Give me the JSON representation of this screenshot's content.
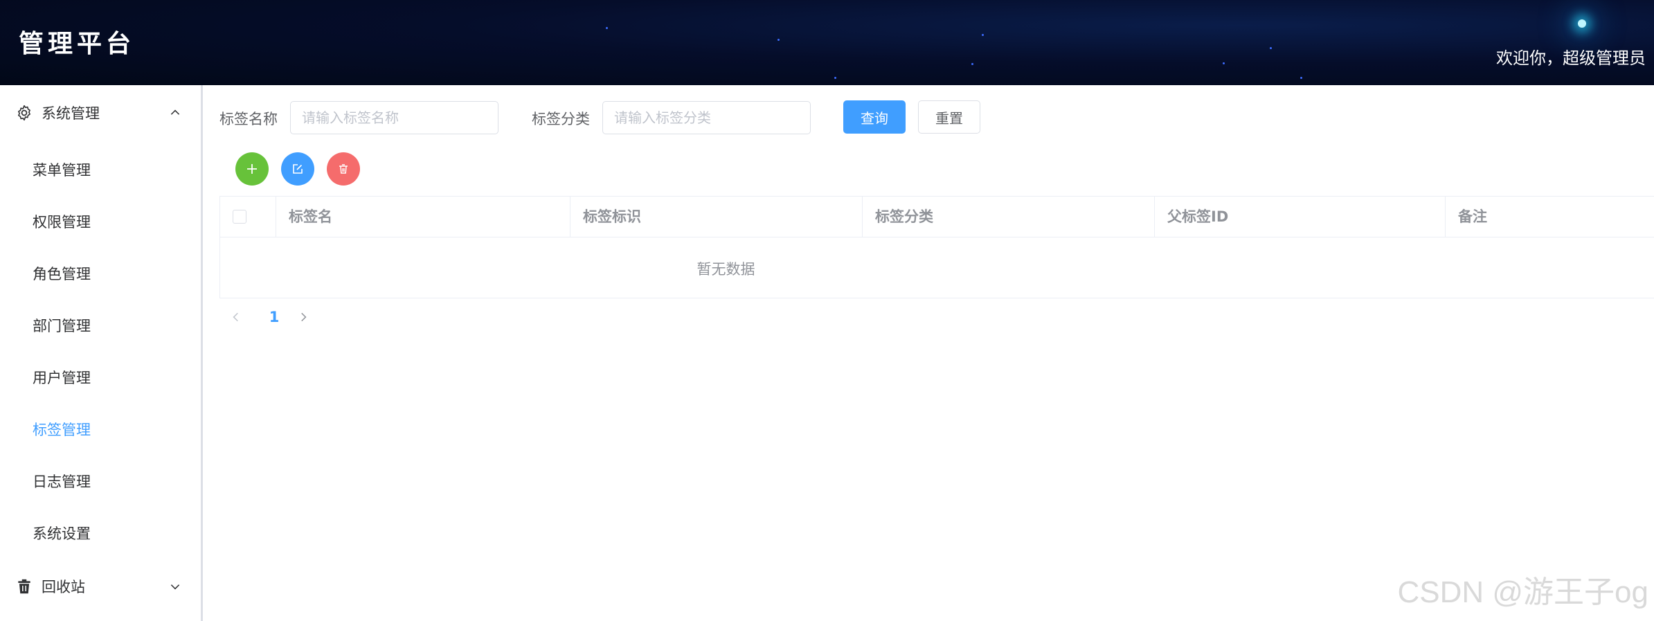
{
  "header": {
    "logo": "管理平台",
    "welcome": "欢迎你，超级管理员"
  },
  "sidebar": {
    "groups": [
      {
        "label": "系统管理",
        "icon": "gear-icon",
        "expanded": true
      },
      {
        "label": "回收站",
        "icon": "trash-icon",
        "expanded": false
      }
    ],
    "items": [
      {
        "label": "菜单管理"
      },
      {
        "label": "权限管理"
      },
      {
        "label": "角色管理"
      },
      {
        "label": "部门管理"
      },
      {
        "label": "用户管理"
      },
      {
        "label": "标签管理",
        "active": true
      },
      {
        "label": "日志管理"
      },
      {
        "label": "系统设置"
      }
    ]
  },
  "search": {
    "name_label": "标签名称",
    "name_placeholder": "请输入标签名称",
    "category_label": "标签分类",
    "category_placeholder": "请输入标签分类",
    "query_button": "查询",
    "reset_button": "重置"
  },
  "toolbar": {
    "add_icon": "plus-icon",
    "edit_icon": "edit-icon",
    "delete_icon": "delete-icon"
  },
  "table": {
    "columns": [
      "标签名",
      "标签标识",
      "标签分类",
      "父标签ID",
      "备注"
    ],
    "empty_text": "暂无数据"
  },
  "pagination": {
    "current_page": "1"
  },
  "watermark": "CSDN @游王子og",
  "colors": {
    "primary": "#409eff",
    "success": "#67c23a",
    "danger": "#f56c6c",
    "header_bg": "#020817"
  }
}
